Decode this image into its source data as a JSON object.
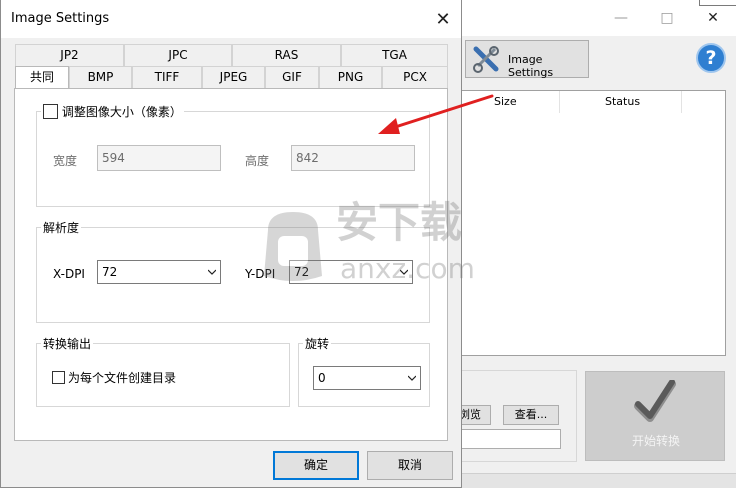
{
  "dialog": {
    "title": "Image Settings",
    "tabs_row1": [
      "JP2",
      "JPC",
      "RAS",
      "TGA"
    ],
    "tabs_row2": [
      "共同",
      "BMP",
      "TIFF",
      "JPEG",
      "GIF",
      "PNG",
      "PCX"
    ],
    "active_tab": "共同",
    "resize": {
      "checkbox_label": "调整图像大小（像素）",
      "checked": false,
      "width_label": "宽度",
      "width_value": "594",
      "height_label": "高度",
      "height_value": "842"
    },
    "resolution": {
      "legend": "解析度",
      "xdpi_label": "X-DPI",
      "xdpi_value": "72",
      "ydpi_label": "Y-DPI",
      "ydpi_value": "72"
    },
    "output": {
      "legend": "转换输出",
      "checkbox_label": "为每个文件创建目录",
      "checked": false
    },
    "rotation": {
      "legend": "旋转",
      "value": "0"
    },
    "ok_label": "确定",
    "cancel_label": "取消"
  },
  "main_window": {
    "image_settings_label": "Image Settings",
    "columns": [
      "Size",
      "Status"
    ],
    "browse_label": "浏览",
    "view_label": "查看...",
    "start_label": "开始转换"
  },
  "watermark": {
    "text": "安下载",
    "subtext": "anxz.com"
  },
  "colors": {
    "accent": "#0078d7",
    "arrow": "#e02020",
    "help": "#2f7fd1"
  }
}
